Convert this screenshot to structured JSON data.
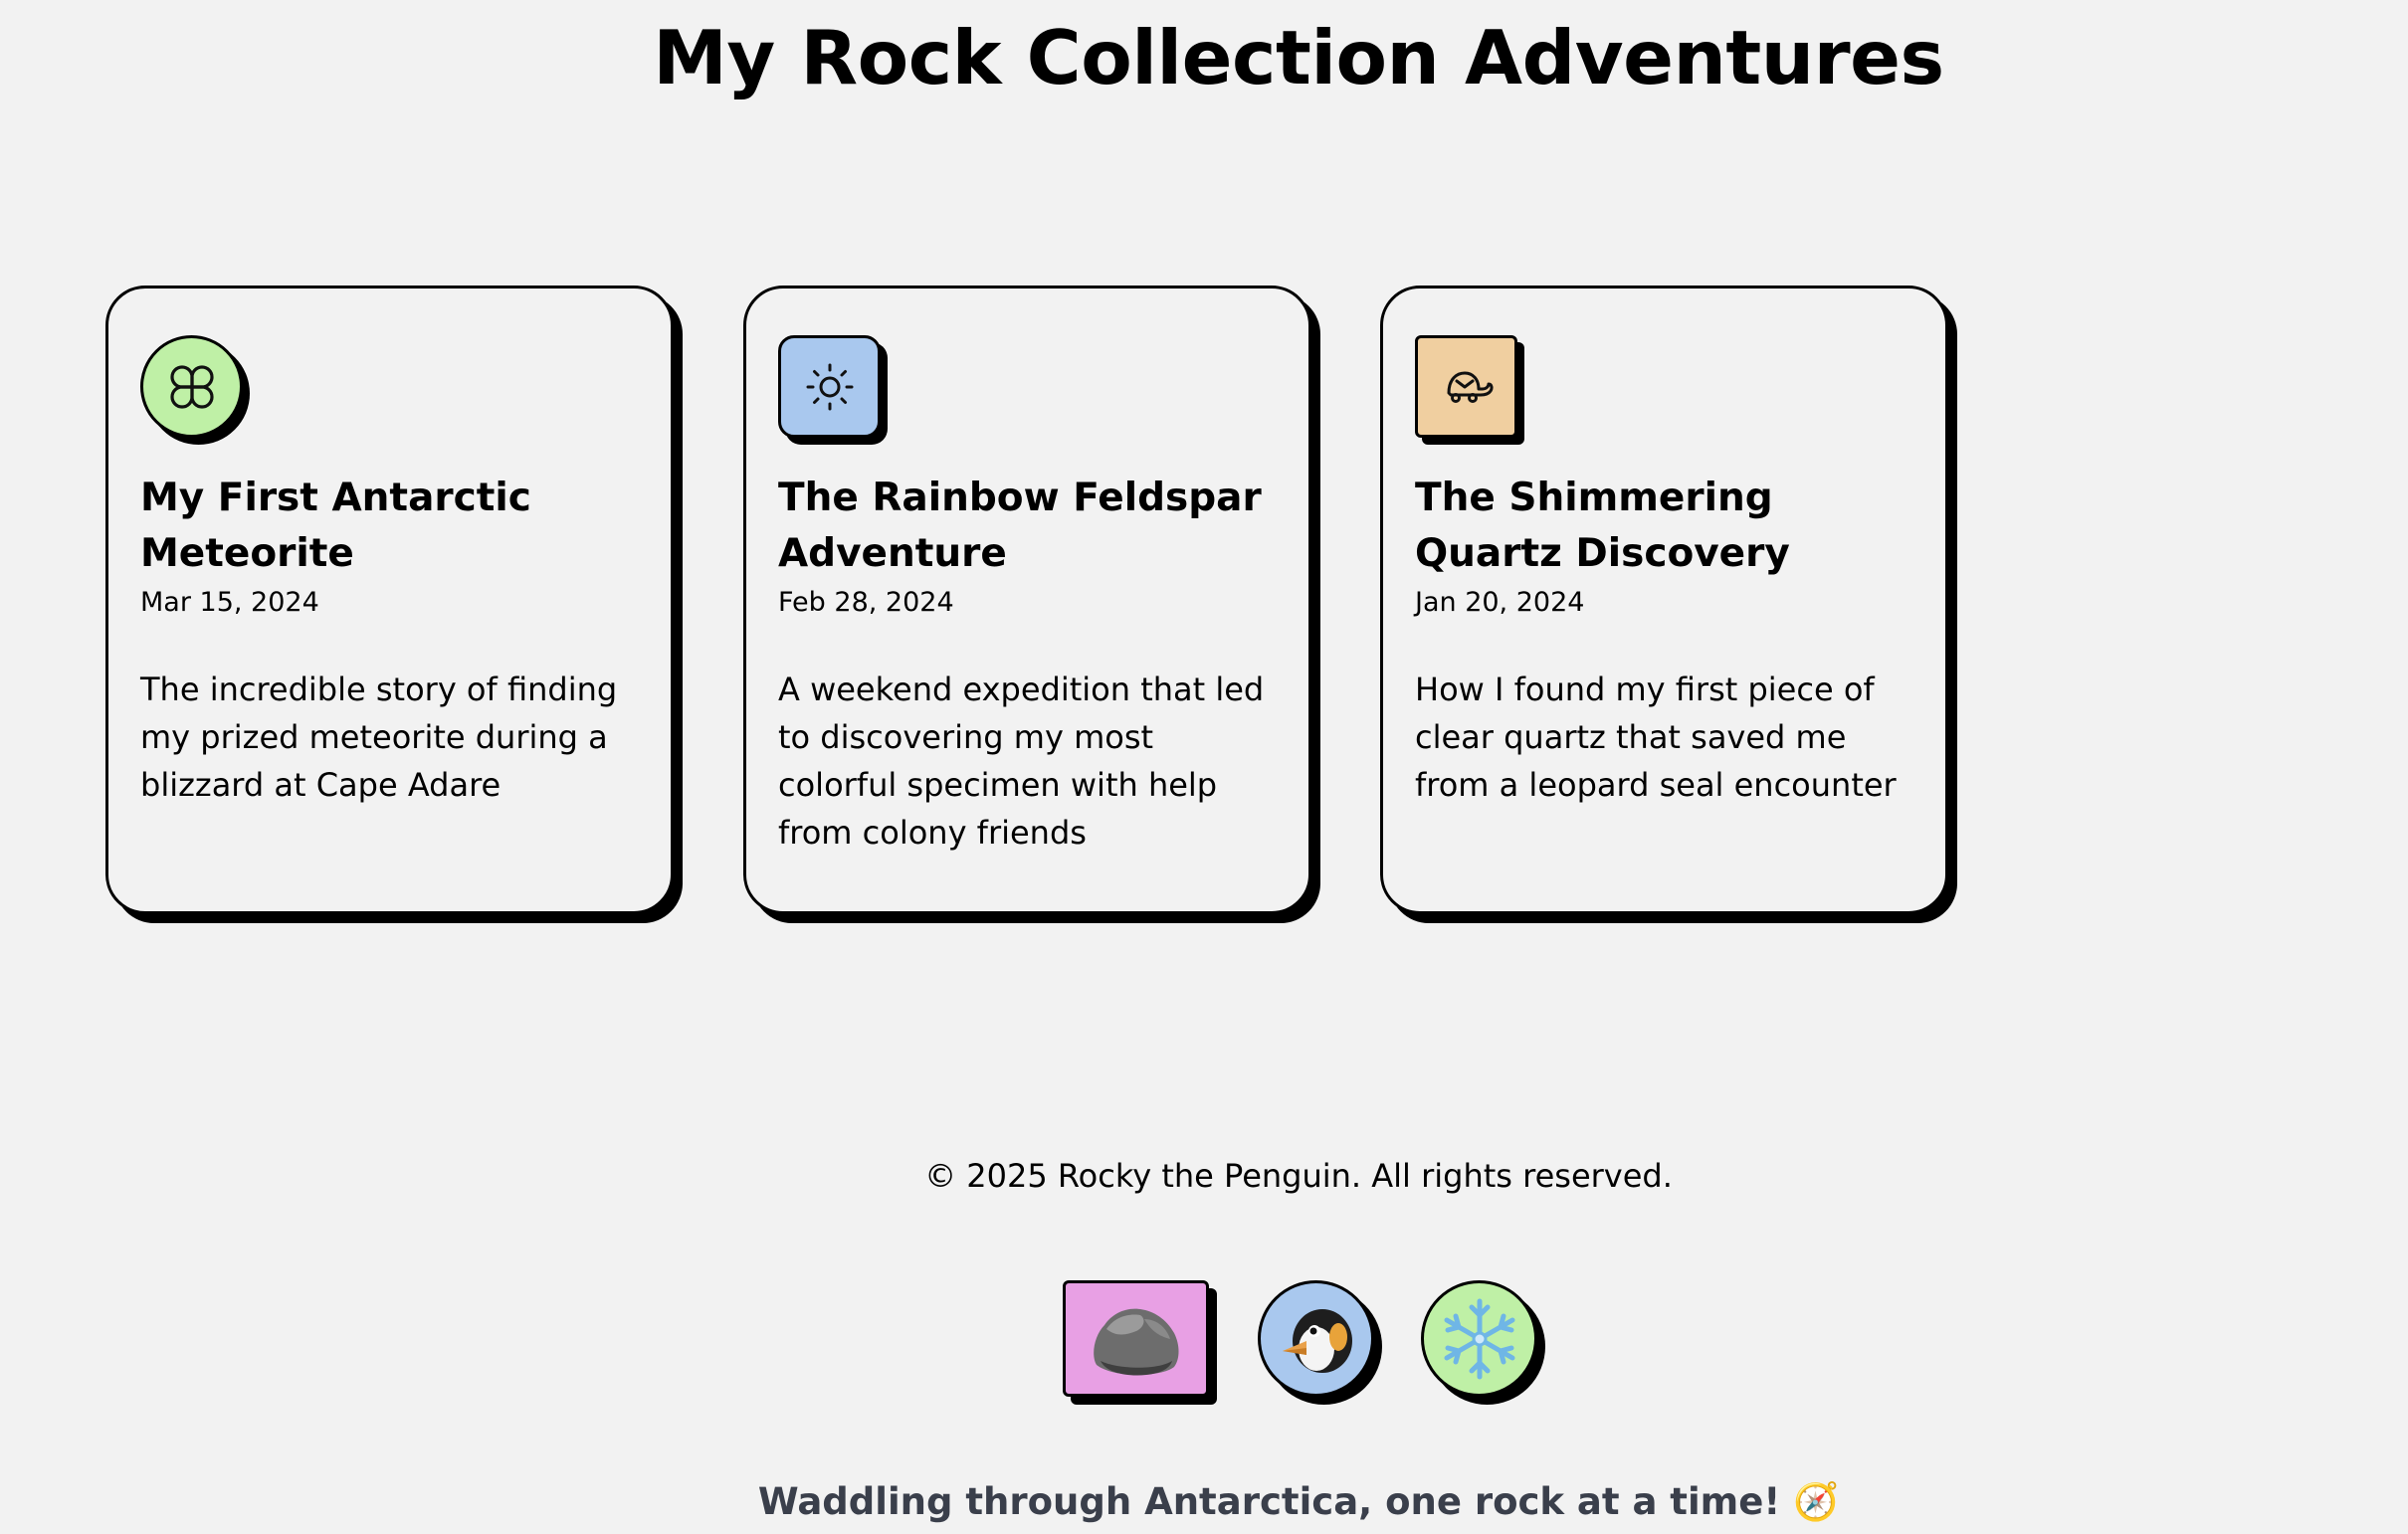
{
  "header": {
    "title": "My Rock Collection Adventures"
  },
  "posts": [
    {
      "title": "My First Antarctic Meteorite",
      "date": "Mar 15, 2024",
      "description": "The incredible story of finding my prized meteorite during a blizzard at Cape Adare",
      "icon": "clover-icon",
      "icon_bg": "#bff0a6"
    },
    {
      "title": "The Rainbow Feldspar Adventure",
      "date": "Feb 28, 2024",
      "description": "A weekend expedition that led to discovering my most colorful specimen with help from colony friends",
      "icon": "sun-icon",
      "icon_bg": "#a9c8ee"
    },
    {
      "title": "The Shimmering Quartz Discovery",
      "date": "Jan 20, 2024",
      "description": "How I found my first piece of clear quartz that saved me from a leopard seal encounter",
      "icon": "turtle-icon",
      "icon_bg": "#f0cfa0"
    }
  ],
  "footer": {
    "copyright": "© 2025 Rocky the Penguin. All rights reserved.",
    "badges": [
      {
        "icon": "rock-icon",
        "bg": "#e8a0e4"
      },
      {
        "icon": "penguin-icon",
        "bg": "#a9c8ee"
      },
      {
        "icon": "snowflake-icon",
        "bg": "#bff0a6"
      }
    ],
    "tagline": "Waddling through Antarctica, one rock at a time! 🧭"
  }
}
